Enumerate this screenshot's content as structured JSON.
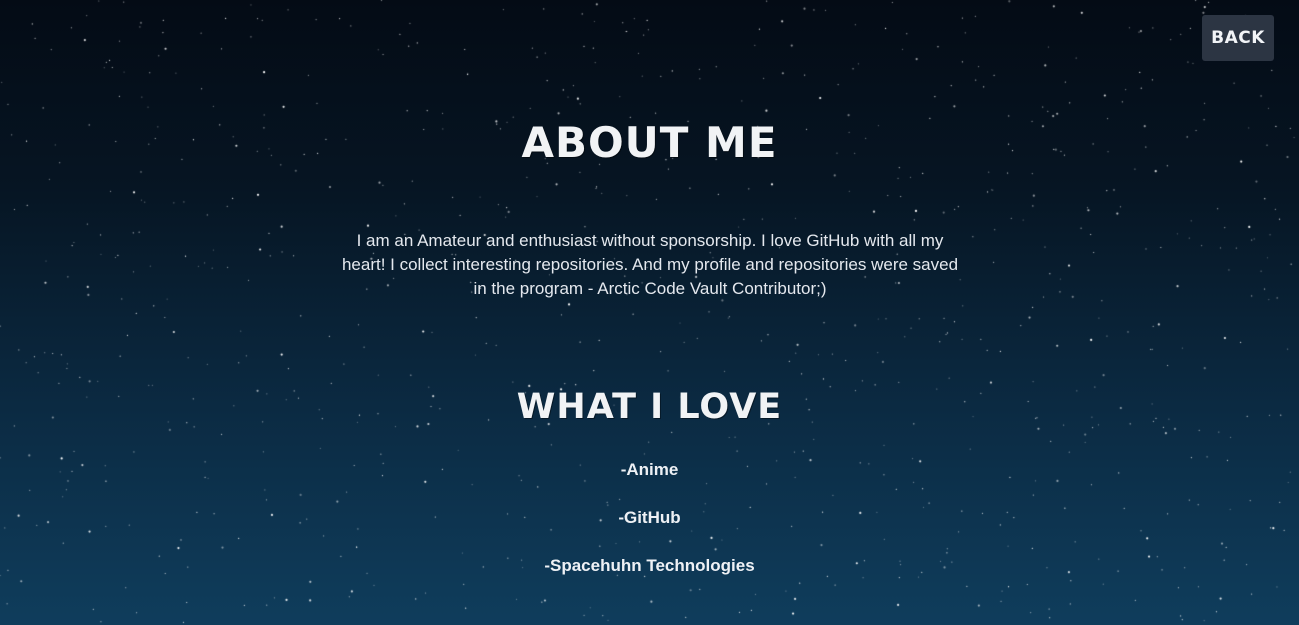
{
  "nav": {
    "back_label": "BACK"
  },
  "about": {
    "heading": "ABOUT ME",
    "text": "I am an Amateur and enthusiast without sponsorship. I love GitHub with all my heart! I collect interesting repositories. And my profile and repositories were saved in the program - Arctic Code Vault Contributor;)"
  },
  "love": {
    "heading": "WHAT I LOVE",
    "items": [
      "-Anime",
      "-GitHub",
      "-Spacehuhn Technologies"
    ]
  },
  "colors": {
    "background_top": "#040b15",
    "background_bottom": "#0f3d5c",
    "button_bg": "#2c3543",
    "text": "#e9edf2"
  }
}
